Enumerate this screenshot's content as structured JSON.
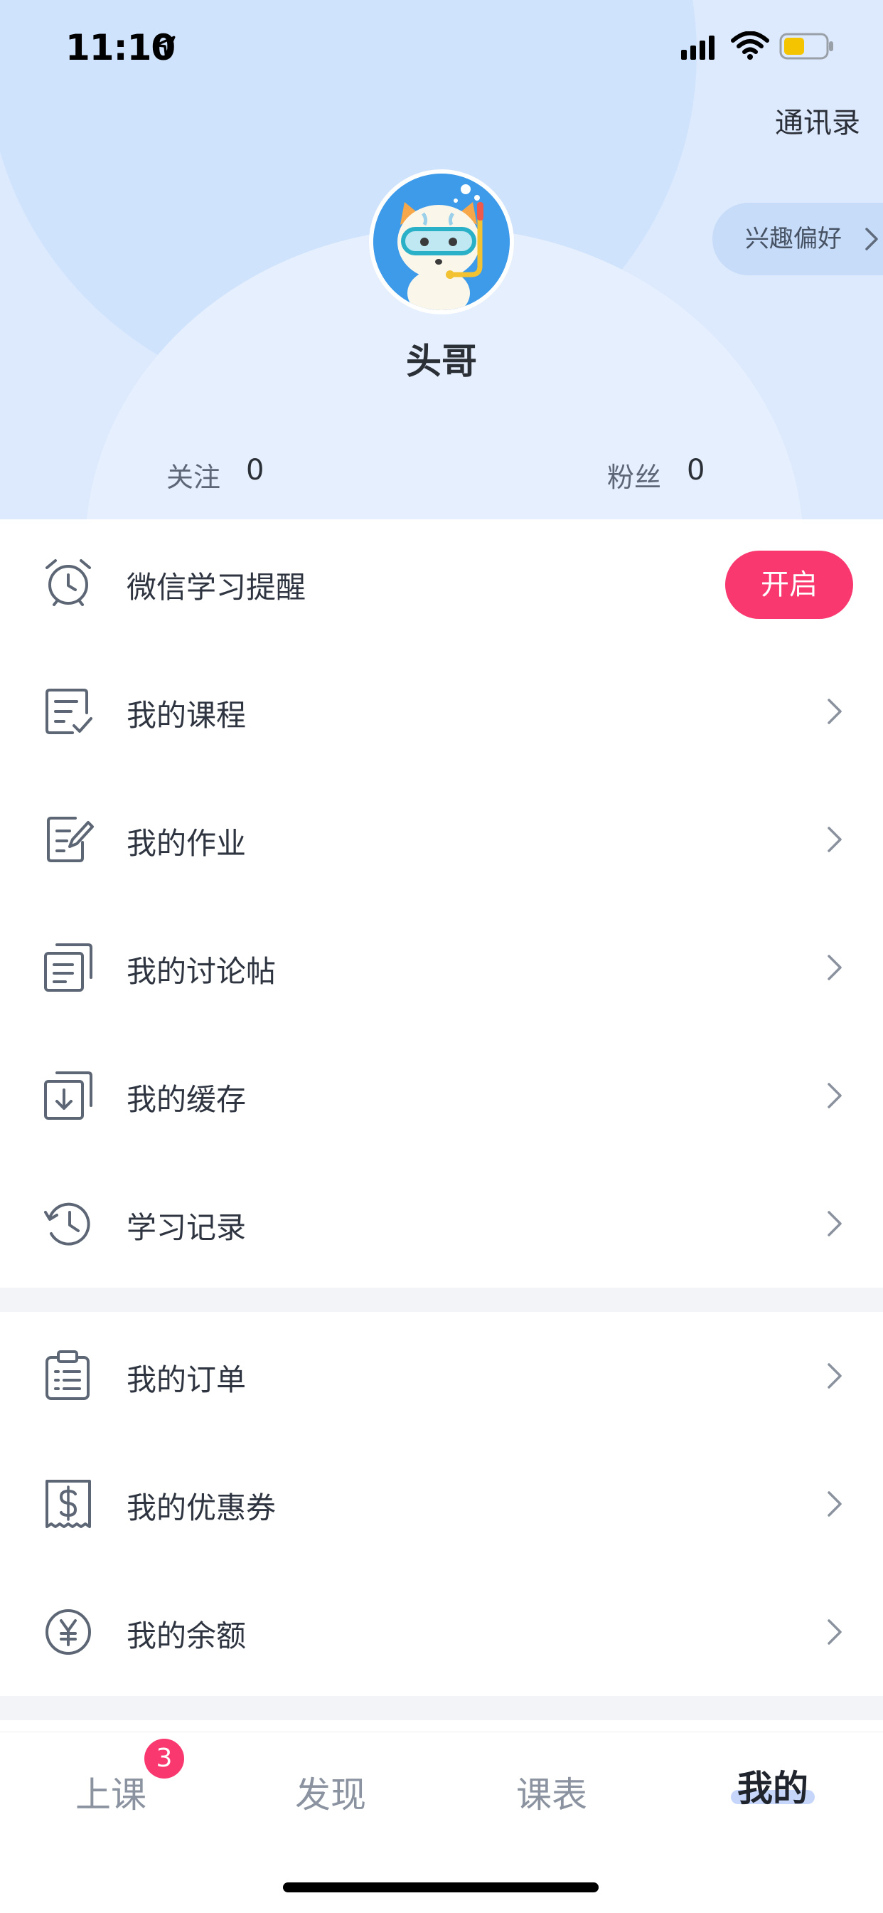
{
  "status_bar": {
    "time": "11:10",
    "battery_color": "#f5c400"
  },
  "header": {
    "contacts_label": "通讯录",
    "interest_label": "兴趣偏好",
    "username": "头哥",
    "following_label": "关注",
    "following_count": "0",
    "followers_label": "粉丝",
    "followers_count": "0"
  },
  "menu": {
    "reminder": {
      "label": "微信学习提醒",
      "button": "开启",
      "icon": "alarm-clock-icon"
    },
    "group1": [
      {
        "label": "我的课程",
        "icon": "course-checklist-icon"
      },
      {
        "label": "我的作业",
        "icon": "homework-edit-icon"
      },
      {
        "label": "我的讨论帖",
        "icon": "discussion-doc-icon"
      },
      {
        "label": "我的缓存",
        "icon": "download-cache-icon"
      },
      {
        "label": "学习记录",
        "icon": "history-clock-icon"
      }
    ],
    "group2": [
      {
        "label": "我的订单",
        "icon": "order-clipboard-icon"
      },
      {
        "label": "我的优惠券",
        "icon": "coupon-ticket-icon"
      },
      {
        "label": "我的余额",
        "icon": "balance-yen-icon"
      }
    ]
  },
  "tabbar": {
    "tabs": [
      "上课",
      "发现",
      "课表",
      "我的"
    ],
    "active": "我的",
    "badge": "3"
  },
  "colors": {
    "accent": "#f8386f",
    "header_bg": "#ddeafd",
    "icon": "#5d6675"
  }
}
